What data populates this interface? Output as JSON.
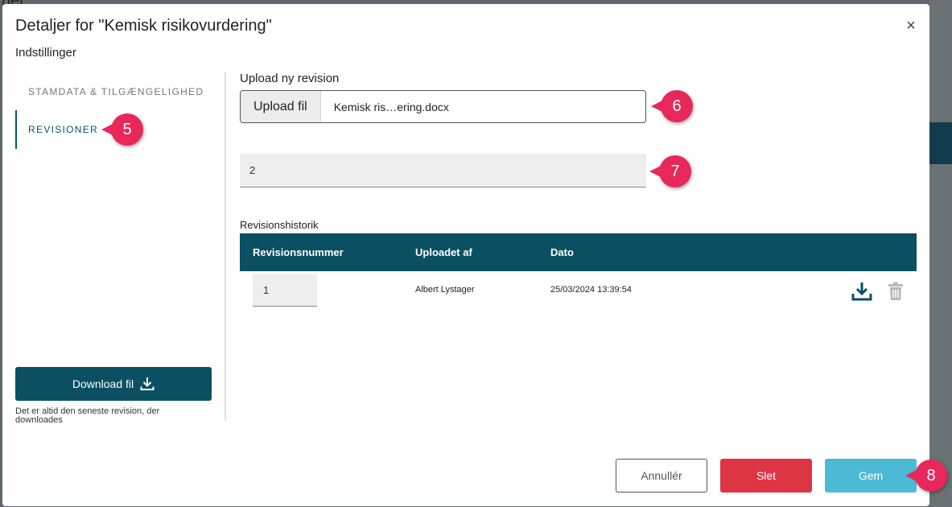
{
  "background": {
    "partial_title": "ner"
  },
  "modal": {
    "title": "Detaljer for \"Kemisk risikovurdering\"",
    "subheading": "Indstillinger",
    "close_symbol": "×"
  },
  "nav": {
    "items": [
      {
        "label": "STAMDATA & TILGÆNGELIGHED",
        "active": false
      },
      {
        "label": "REVISIONER",
        "active": true
      }
    ]
  },
  "download": {
    "label": "Download fil",
    "note": "Det er altid den seneste revision, der downloades"
  },
  "upload": {
    "section_label": "Upload ny revision",
    "button_label": "Upload fil",
    "file_name": "Kemisk ris…ering.docx"
  },
  "revision_field": {
    "value": "2"
  },
  "history": {
    "label": "Revisionshistorik",
    "columns": [
      "Revisionsnummer",
      "Uploadet af",
      "Dato"
    ],
    "rows": [
      {
        "revision": "1",
        "uploaded_by": "Albert Lystager",
        "date": "25/03/2024 13:39:54"
      }
    ]
  },
  "footer": {
    "cancel_label": "Annullér",
    "delete_label": "Slet",
    "save_label": "Gem"
  },
  "callouts": [
    "5",
    "6",
    "7",
    "8"
  ],
  "icons": [
    "close-icon",
    "download-icon",
    "trash-icon"
  ],
  "colors": {
    "primary": "#0b4f63",
    "danger": "#de3545",
    "save": "#4cbad5",
    "callout": "#e8285a"
  }
}
